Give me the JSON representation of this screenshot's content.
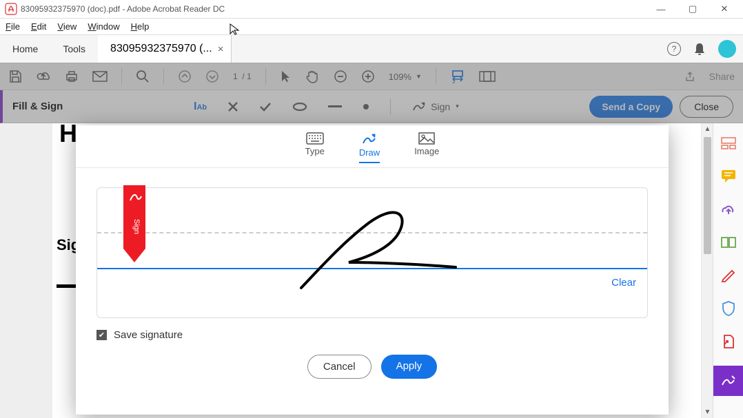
{
  "window": {
    "title": "83095932375970 (doc).pdf - Adobe Acrobat Reader DC",
    "min": "—",
    "max": "▢",
    "close": "✕"
  },
  "menubar": [
    "File",
    "Edit",
    "View",
    "Window",
    "Help"
  ],
  "tabs": {
    "home": "Home",
    "tools": "Tools",
    "doc": "83095932375970 (...",
    "close_x": "×"
  },
  "toolbar": {
    "page_current": "1",
    "page_sep": "/",
    "page_total": "1",
    "zoom": "109%",
    "share": "Share"
  },
  "fillsign": {
    "title": "Fill & Sign",
    "sign_label": "Sign",
    "send_copy": "Send a Copy",
    "close": "Close"
  },
  "dialog": {
    "tabs": {
      "type": "Type",
      "draw": "Draw",
      "image": "Image"
    },
    "clear": "Clear",
    "flag_text": "Sign",
    "save_label": "Save signature",
    "cancel": "Cancel",
    "apply": "Apply"
  },
  "page_fragments": {
    "h": "H",
    "sig": "Sig"
  }
}
